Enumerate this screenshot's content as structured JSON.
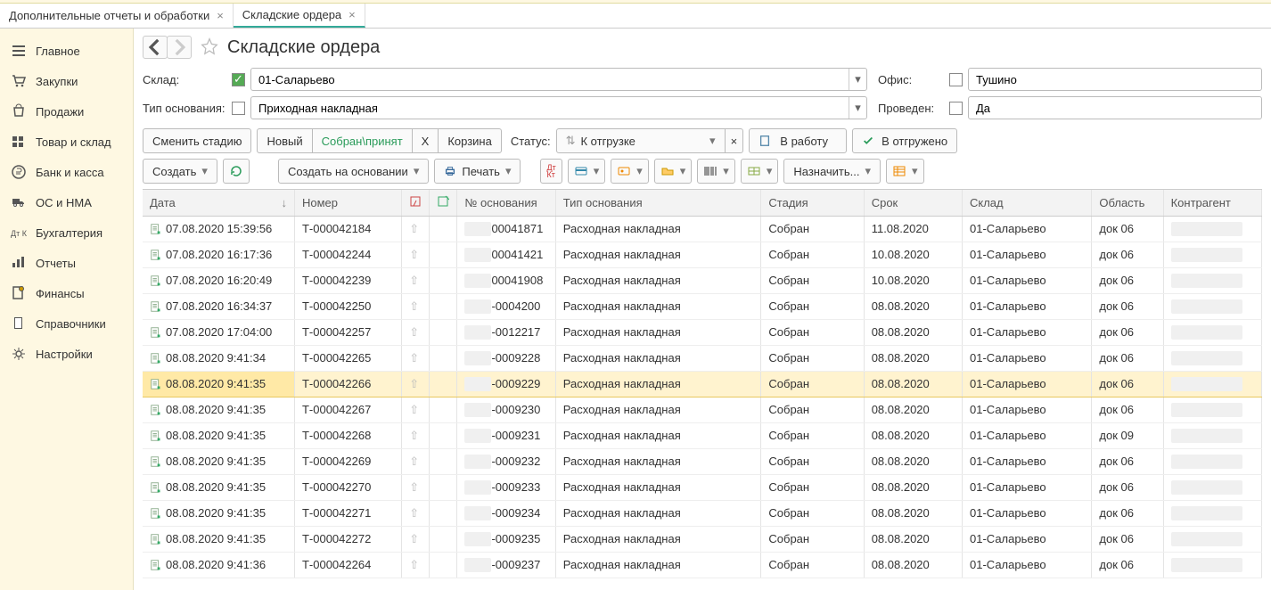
{
  "tabs": [
    {
      "label": "Дополнительные отчеты и обработки"
    },
    {
      "label": "Складские ордера",
      "active": true
    }
  ],
  "sidebar": [
    {
      "icon": "home",
      "label": "Главное"
    },
    {
      "icon": "cart",
      "label": "Закупки"
    },
    {
      "icon": "bag",
      "label": "Продажи"
    },
    {
      "icon": "boxes",
      "label": "Товар и склад"
    },
    {
      "icon": "ruble",
      "label": "Банк и касса"
    },
    {
      "icon": "truck",
      "label": "ОС и НМА"
    },
    {
      "icon": "ledger",
      "label": "Бухгалтерия"
    },
    {
      "icon": "chart",
      "label": "Отчеты"
    },
    {
      "icon": "finance",
      "label": "Финансы"
    },
    {
      "icon": "book",
      "label": "Справочники"
    },
    {
      "icon": "gear",
      "label": "Настройки"
    }
  ],
  "page_title": "Складские ордера",
  "filters": {
    "warehouse_label": "Склад:",
    "warehouse_checked": true,
    "warehouse_value": "01-Саларьево",
    "office_label": "Офис:",
    "office_checked": false,
    "office_value": "Тушино",
    "basis_type_label": "Тип основания:",
    "basis_type_checked": false,
    "basis_type_value": "Приходная накладная",
    "posted_label": "Проведен:",
    "posted_checked": false,
    "posted_value": "Да"
  },
  "toolbar1": {
    "change_stage": "Сменить стадию",
    "new": "Новый",
    "collected": "Собран\\принят",
    "x": "Х",
    "trash": "Корзина",
    "status_label": "Статус:",
    "status_value": "К отгрузке",
    "to_work": "В работу",
    "shipped": "В отгружено"
  },
  "toolbar2": {
    "create": "Создать",
    "create_on_basis": "Создать на основании",
    "print": "Печать",
    "assign": "Назначить..."
  },
  "columns": [
    "Дата",
    "Номер",
    "",
    "",
    "№ основания",
    "Тип основания",
    "Стадия",
    "Срок",
    "Склад",
    "Область",
    "Контрагент"
  ],
  "rows": [
    {
      "date": "07.08.2020 15:39:56",
      "num": "Т-000042184",
      "basis_suffix": "00041871",
      "btype": "Расходная накладная",
      "stage": "Собран",
      "due": "11.08.2020",
      "wh": "01-Саларьево",
      "area": "док 06"
    },
    {
      "date": "07.08.2020 16:17:36",
      "num": "Т-000042244",
      "basis_suffix": "00041421",
      "btype": "Расходная накладная",
      "stage": "Собран",
      "due": "10.08.2020",
      "wh": "01-Саларьево",
      "area": "док 06"
    },
    {
      "date": "07.08.2020 16:20:49",
      "num": "Т-000042239",
      "basis_suffix": "00041908",
      "btype": "Расходная накладная",
      "stage": "Собран",
      "due": "10.08.2020",
      "wh": "01-Саларьево",
      "area": "док 06"
    },
    {
      "date": "07.08.2020 16:34:37",
      "num": "Т-000042250",
      "basis_suffix": "-0004200",
      "btype": "Расходная накладная",
      "stage": "Собран",
      "due": "08.08.2020",
      "wh": "01-Саларьево",
      "area": "док 06"
    },
    {
      "date": "07.08.2020 17:04:00",
      "num": "Т-000042257",
      "basis_suffix": "-0012217",
      "btype": "Расходная накладная",
      "stage": "Собран",
      "due": "08.08.2020",
      "wh": "01-Саларьево",
      "area": "док 06"
    },
    {
      "date": "08.08.2020 9:41:34",
      "num": "Т-000042265",
      "basis_suffix": "-0009228",
      "btype": "Расходная накладная",
      "stage": "Собран",
      "due": "08.08.2020",
      "wh": "01-Саларьево",
      "area": "док 06"
    },
    {
      "date": "08.08.2020 9:41:35",
      "num": "Т-000042266",
      "basis_suffix": "-0009229",
      "btype": "Расходная накладная",
      "stage": "Собран",
      "due": "08.08.2020",
      "wh": "01-Саларьево",
      "area": "док 06",
      "selected": true
    },
    {
      "date": "08.08.2020 9:41:35",
      "num": "Т-000042267",
      "basis_suffix": "-0009230",
      "btype": "Расходная накладная",
      "stage": "Собран",
      "due": "08.08.2020",
      "wh": "01-Саларьево",
      "area": "док 06"
    },
    {
      "date": "08.08.2020 9:41:35",
      "num": "Т-000042268",
      "basis_suffix": "-0009231",
      "btype": "Расходная накладная",
      "stage": "Собран",
      "due": "08.08.2020",
      "wh": "01-Саларьево",
      "area": "док 09"
    },
    {
      "date": "08.08.2020 9:41:35",
      "num": "Т-000042269",
      "basis_suffix": "-0009232",
      "btype": "Расходная накладная",
      "stage": "Собран",
      "due": "08.08.2020",
      "wh": "01-Саларьево",
      "area": "док 06"
    },
    {
      "date": "08.08.2020 9:41:35",
      "num": "Т-000042270",
      "basis_suffix": "-0009233",
      "btype": "Расходная накладная",
      "stage": "Собран",
      "due": "08.08.2020",
      "wh": "01-Саларьево",
      "area": "док 06"
    },
    {
      "date": "08.08.2020 9:41:35",
      "num": "Т-000042271",
      "basis_suffix": "-0009234",
      "btype": "Расходная накладная",
      "stage": "Собран",
      "due": "08.08.2020",
      "wh": "01-Саларьево",
      "area": "док 06"
    },
    {
      "date": "08.08.2020 9:41:35",
      "num": "Т-000042272",
      "basis_suffix": "-0009235",
      "btype": "Расходная накладная",
      "stage": "Собран",
      "due": "08.08.2020",
      "wh": "01-Саларьево",
      "area": "док 06"
    },
    {
      "date": "08.08.2020 9:41:36",
      "num": "Т-000042264",
      "basis_suffix": "-0009237",
      "btype": "Расходная накладная",
      "stage": "Собран",
      "due": "08.08.2020",
      "wh": "01-Саларьево",
      "area": "док 06"
    }
  ]
}
